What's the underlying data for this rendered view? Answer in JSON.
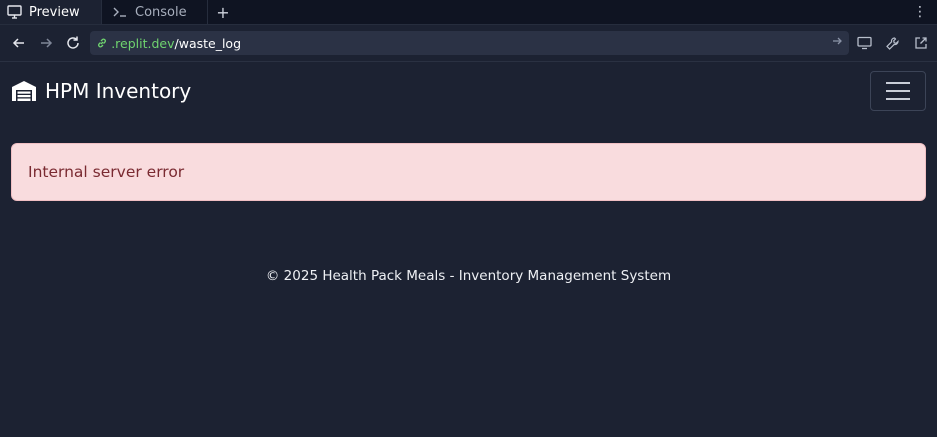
{
  "browser": {
    "tabs": [
      {
        "label": "Preview",
        "icon": "monitor-icon",
        "active": true
      },
      {
        "label": "Console",
        "icon": "terminal-icon",
        "active": false
      }
    ],
    "new_tab": "+",
    "menu": "⋮",
    "url": {
      "domain": ".replit.dev",
      "path": "/waste_log"
    }
  },
  "app": {
    "brand": "HPM Inventory",
    "brand_icon": "warehouse-icon"
  },
  "alert": {
    "message": "Internal server error",
    "color": "#f9dcde"
  },
  "footer": {
    "text": "© 2025 Health Pack Meals - Inventory Management System"
  }
}
